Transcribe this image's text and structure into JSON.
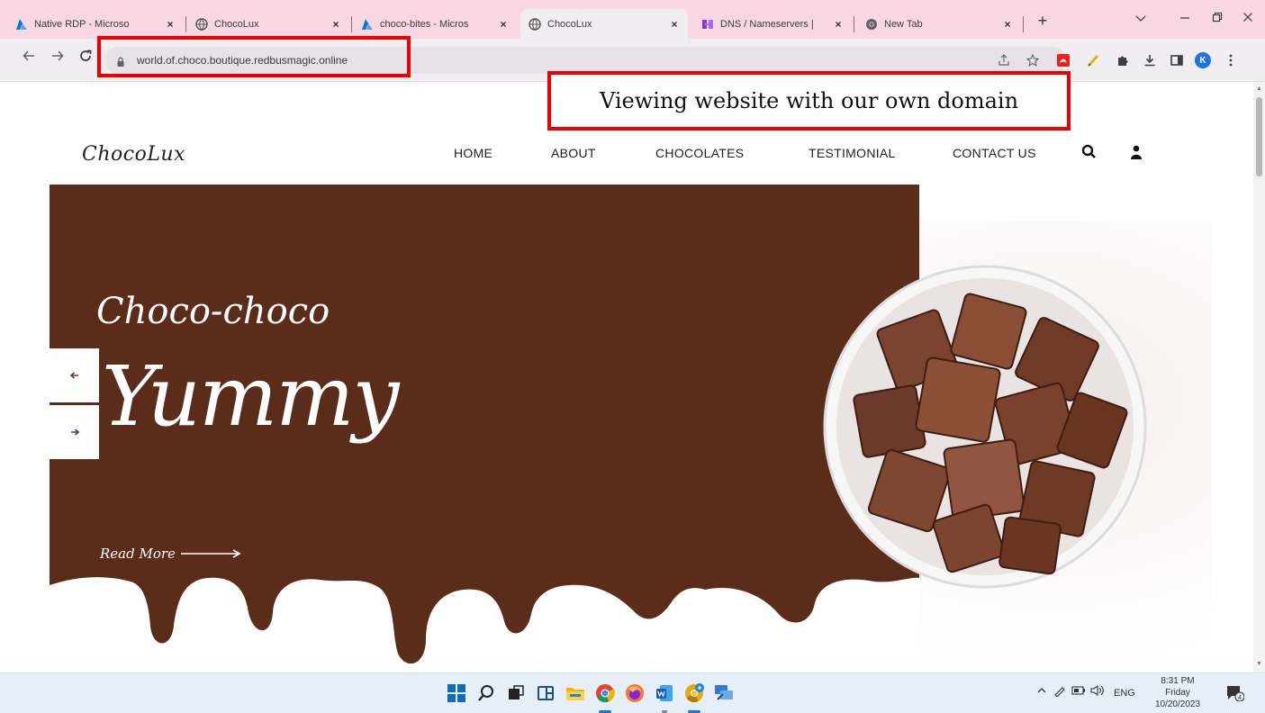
{
  "browser": {
    "tabs": [
      {
        "title": "Native RDP - Microso",
        "icon": "azure-icon"
      },
      {
        "title": "ChocoLux",
        "icon": "globe-icon"
      },
      {
        "title": "choco-bites - Micros",
        "icon": "azure-icon"
      },
      {
        "title": "ChocoLux",
        "icon": "globe-icon",
        "active": true
      },
      {
        "title": "DNS / Nameservers |",
        "icon": "dns-icon"
      },
      {
        "title": "New Tab",
        "icon": "chrome-icon"
      }
    ],
    "tab_close_glyph": "×",
    "new_tab_glyph": "+",
    "url": "world.of.choco.boutique.redbusmagic.online",
    "profile_initial": "K"
  },
  "site": {
    "logo": "ChocoLux",
    "menu": [
      "HOME",
      "ABOUT",
      "CHOCOLATES",
      "TESTIMONIAL",
      "CONTACT US"
    ],
    "hero": {
      "kicker": "Choco-choco",
      "title": "Yummy",
      "read_more": "Read More"
    }
  },
  "annotation": {
    "callout": "Viewing website with our own domain",
    "color": "#ee0000"
  },
  "taskbar": {
    "tray": {
      "language": "ENG"
    },
    "clock": {
      "time": "8:31 PM",
      "day": "Friday",
      "date": "10/20/2023"
    },
    "notification_count": "4"
  },
  "colors": {
    "tab_strip": "#f9d7e2",
    "hero_brown": "#5c2c1b",
    "chocolate": "#6b3a2a"
  }
}
